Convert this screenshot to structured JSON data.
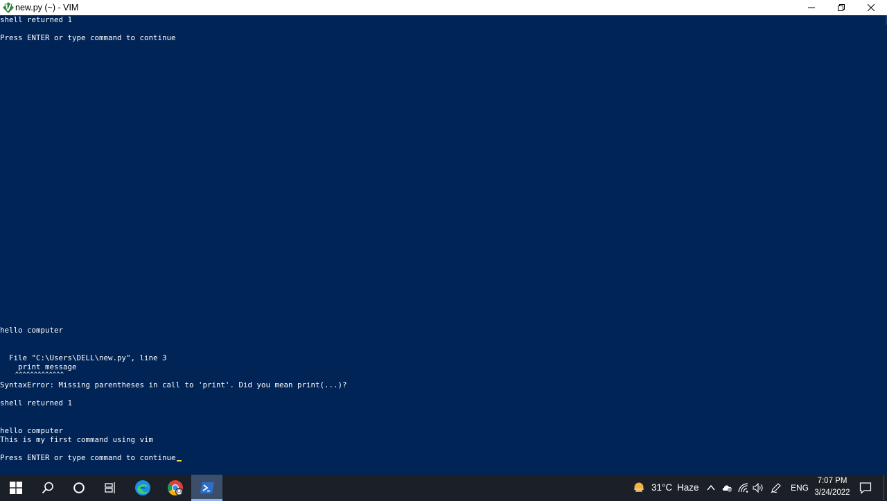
{
  "window": {
    "title": "new.py (~) - VIM",
    "controls": [
      "minimize",
      "restore",
      "close"
    ]
  },
  "terminal": {
    "lines": [
      "shell returned 1",
      "",
      "Press ENTER or type command to continue",
      "hello computer",
      "",
      "",
      "  File \"C:\\Users\\DELL\\new.py\", line 3",
      "    print message",
      "    ^^^^^^^^^^^^^",
      "SyntaxError: Missing parentheses in call to 'print'. Did you mean print(...)?",
      "",
      "shell returned 1",
      "",
      "",
      "hello computer",
      "This is my first command using vim",
      "",
      "Press ENTER or type command to continue"
    ],
    "cursor_color": "#ffd24a",
    "background": "#012456",
    "foreground": "#ffffff"
  },
  "taskbar": {
    "apps": [
      {
        "name": "start",
        "icon": "windows-logo-icon"
      },
      {
        "name": "search",
        "icon": "search-icon"
      },
      {
        "name": "cortana",
        "icon": "cortana-circle-icon"
      },
      {
        "name": "task-view",
        "icon": "task-view-icon"
      },
      {
        "name": "edge",
        "icon": "edge-icon"
      },
      {
        "name": "chrome",
        "icon": "chrome-icon"
      },
      {
        "name": "powershell",
        "icon": "powershell-icon",
        "active": true
      }
    ],
    "weather": {
      "temp": "31°C",
      "condition": "Haze"
    },
    "language": "ENG",
    "time": "7:07 PM",
    "date": "3/24/2022"
  }
}
